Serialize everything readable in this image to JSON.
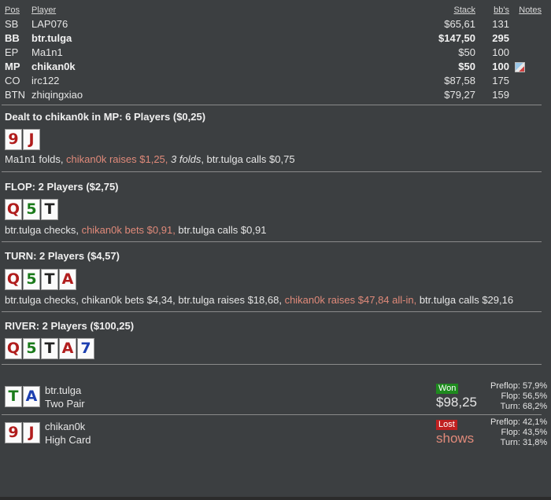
{
  "header": {
    "pos": "Pos",
    "player": "Player",
    "stack": "Stack",
    "bb": "bb's",
    "notes": "Notes"
  },
  "players": [
    {
      "pos": "SB",
      "name": "LAP076",
      "stack": "$65,61",
      "bb": "131",
      "bold": false
    },
    {
      "pos": "BB",
      "name": "btr.tulga",
      "stack": "$147,50",
      "bb": "295",
      "bold": true
    },
    {
      "pos": "EP",
      "name": "Ma1n1",
      "stack": "$50",
      "bb": "100",
      "bold": false
    },
    {
      "pos": "MP",
      "name": "chikan0k",
      "stack": "$50",
      "bb": "100",
      "bold": true,
      "note_icon": "note-icon"
    },
    {
      "pos": "CO",
      "name": "irc122",
      "stack": "$87,58",
      "bb": "175",
      "bold": false
    },
    {
      "pos": "BTN",
      "name": "zhiqingxiao",
      "stack": "$79,27",
      "bb": "159",
      "bold": false
    }
  ],
  "preflop": {
    "title": "Dealt to chikan0k in MP: 6 Players ($0,25)",
    "cards": [
      {
        "rank": "9",
        "suit": "h"
      },
      {
        "rank": "J",
        "suit": "h"
      }
    ],
    "actions": [
      {
        "text": "Ma1n1 folds, ",
        "style": "normal"
      },
      {
        "text": "chikan0k raises $1,25, ",
        "style": "hero"
      },
      {
        "text": "3 folds",
        "style": "italic"
      },
      {
        "text": ", btr.tulga calls $0,75",
        "style": "normal"
      }
    ]
  },
  "flop": {
    "title": "FLOP: 2 Players ($2,75)",
    "cards": [
      {
        "rank": "Q",
        "suit": "h"
      },
      {
        "rank": "5",
        "suit": "c"
      },
      {
        "rank": "T",
        "suit": "s"
      }
    ],
    "actions": [
      {
        "text": "btr.tulga checks, ",
        "style": "normal"
      },
      {
        "text": "chikan0k bets $0,91, ",
        "style": "hero"
      },
      {
        "text": "btr.tulga calls $0,91",
        "style": "normal"
      }
    ]
  },
  "turn": {
    "title": "TURN: 2 Players ($4,57)",
    "cards": [
      {
        "rank": "Q",
        "suit": "h"
      },
      {
        "rank": "5",
        "suit": "c"
      },
      {
        "rank": "T",
        "suit": "s"
      },
      {
        "rank": "A",
        "suit": "h"
      }
    ],
    "actions": [
      {
        "text": "btr.tulga checks, chikan0k bets $4,34, btr.tulga raises $18,68, ",
        "style": "normal"
      },
      {
        "text": "chikan0k raises $47,84 all-in, ",
        "style": "hero"
      },
      {
        "text": "btr.tulga calls $29,16",
        "style": "normal"
      }
    ]
  },
  "river": {
    "title": "RIVER: 2 Players ($100,25)",
    "cards": [
      {
        "rank": "Q",
        "suit": "h"
      },
      {
        "rank": "5",
        "suit": "c"
      },
      {
        "rank": "T",
        "suit": "s"
      },
      {
        "rank": "A",
        "suit": "h"
      },
      {
        "rank": "7",
        "suit": "d"
      }
    ]
  },
  "results": [
    {
      "cards": [
        {
          "rank": "T",
          "suit": "c"
        },
        {
          "rank": "A",
          "suit": "d"
        }
      ],
      "name": "btr.tulga",
      "hand": "Two Pair",
      "badge": "Won",
      "amount": "$98,25",
      "stats": [
        {
          "label": "Preflop:",
          "value": "57,9%"
        },
        {
          "label": "Flop:",
          "value": "56,5%"
        },
        {
          "label": "Turn:",
          "value": "68,2%"
        }
      ]
    },
    {
      "cards": [
        {
          "rank": "9",
          "suit": "h"
        },
        {
          "rank": "J",
          "suit": "h"
        }
      ],
      "name": "chikan0k",
      "hand": "High Card",
      "badge": "Lost",
      "amount": "shows",
      "stats": [
        {
          "label": "Preflop:",
          "value": "42,1%"
        },
        {
          "label": "Flop:",
          "value": "43,5%"
        },
        {
          "label": "Turn:",
          "value": "31,8%"
        }
      ]
    }
  ],
  "colors": {
    "hero": "#e08a7a",
    "heart": "#b01c1c",
    "club": "#1a7a1a",
    "spade": "#222222",
    "diamond": "#1c3fb0",
    "won": "#1e8a1e",
    "lost": "#c02020"
  }
}
